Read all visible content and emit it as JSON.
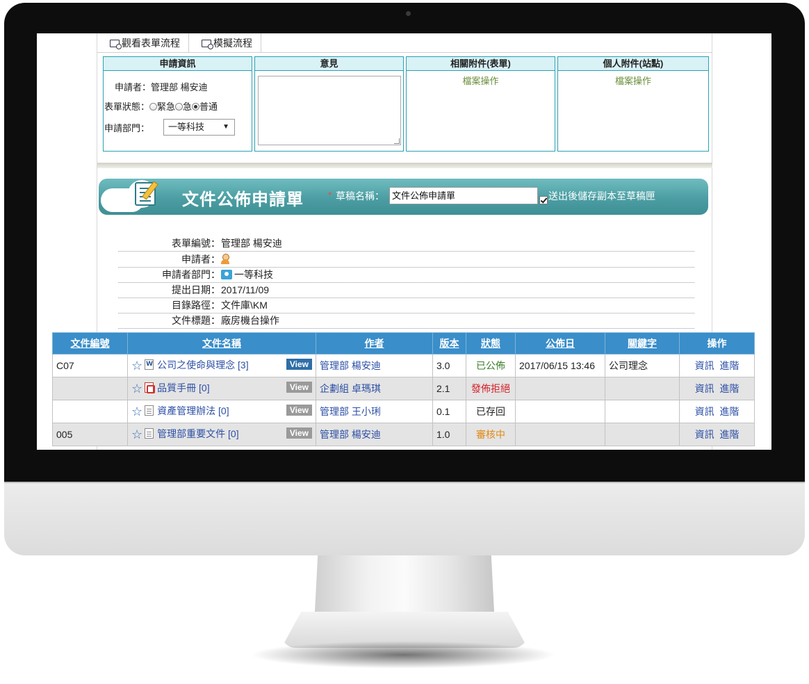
{
  "tabs": [
    "觀看表單流程",
    "模擬流程"
  ],
  "panels": {
    "apply_info": {
      "header": "申請資訊",
      "applicant_label": "申請者：",
      "applicant_value": "管理部 楊安迪",
      "status_label": "表單狀態：",
      "status_options": [
        "緊急",
        "急",
        "普通"
      ],
      "status_selected": "普通",
      "dept_label": "申請部門：",
      "dept_value": "一等科技"
    },
    "opinion": {
      "header": "意見"
    },
    "attach_form": {
      "header": "相關附件(表單)",
      "action": "檔案操作"
    },
    "attach_personal": {
      "header": "個人附件(站點)",
      "action": "檔案操作"
    }
  },
  "banner": {
    "title": "文件公佈申請單",
    "required_mark": "*",
    "draft_label": "草稿名稱：",
    "draft_value": "文件公佈申請單",
    "save_copy_label": "送出後儲存副本至草稿匣"
  },
  "details": [
    {
      "label": "表單編號：",
      "value": "管理部 楊安迪"
    },
    {
      "label": "申請者：",
      "value": ""
    },
    {
      "label": "申請者部門：",
      "value": "一等科技"
    },
    {
      "label": "提出日期：",
      "value": "2017/11/09"
    },
    {
      "label": "目錄路徑：",
      "value": "文件庫\\KM"
    },
    {
      "label": "文件標題：",
      "value": "廠房機台操作"
    }
  ],
  "table": {
    "headers": [
      "文件編號",
      "文件名稱",
      "作者",
      "版本",
      "狀態",
      "公佈日",
      "關鍵字",
      "操作"
    ],
    "view_label": "View",
    "info_label": "資訊",
    "advanced_label": "進階",
    "rows": [
      {
        "id": "C07",
        "name": "公司之使命與理念 [3]",
        "icon": "word-doc-icon",
        "author": "管理部 楊安迪",
        "version": "3.0",
        "status": "已公佈",
        "status_color": "#3a7d2a",
        "date": "2017/06/15 13:46",
        "keyword": "公司理念"
      },
      {
        "id": "",
        "name": "品質手冊 [0]",
        "icon": "pdf-icon",
        "author": "企劃組 卓瑪琪",
        "version": "2.1",
        "status": "發佈拒絕",
        "status_color": "#d4202a",
        "date": "",
        "keyword": ""
      },
      {
        "id": "",
        "name": "資產管理辦法 [0]",
        "icon": "text-doc-icon",
        "author": "管理部 王小琍",
        "version": "0.1",
        "status": "已存回",
        "status_color": "#222222",
        "date": "",
        "keyword": ""
      },
      {
        "id": "005",
        "name": "管理部重要文件 [0]",
        "icon": "text-doc-icon",
        "author": "管理部 楊安迪",
        "version": "1.0",
        "status": "審核中",
        "status_color": "#e08a15",
        "date": "",
        "keyword": ""
      }
    ]
  }
}
